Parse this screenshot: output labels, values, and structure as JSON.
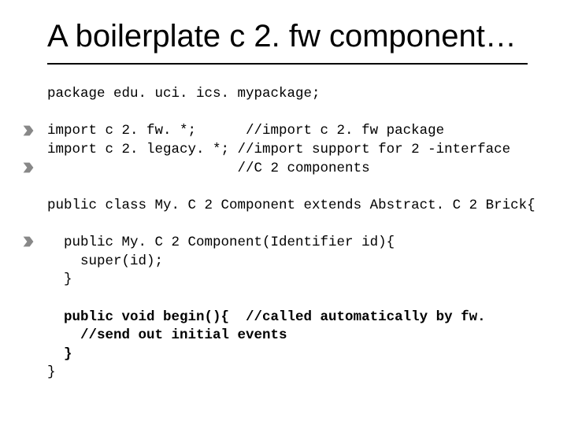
{
  "title": "A boilerplate c 2. fw component…",
  "code": {
    "l1": "package edu. uci. ics. mypackage;",
    "l2": "import c 2. fw. *;      //import c 2. fw package",
    "l3": "import c 2. legacy. *; //import support for 2 -interface",
    "l4": "                       //C 2 components",
    "l5": "public class My. C 2 Component extends Abstract. C 2 Brick{",
    "l6": "  public My. C 2 Component(Identifier id){",
    "l7": "    super(id);",
    "l8": "  }",
    "l9a": "  public void begin(){  //called automatically by fw.",
    "l9b": "    //send out initial events",
    "l9c": "  }",
    "l10": "}"
  }
}
